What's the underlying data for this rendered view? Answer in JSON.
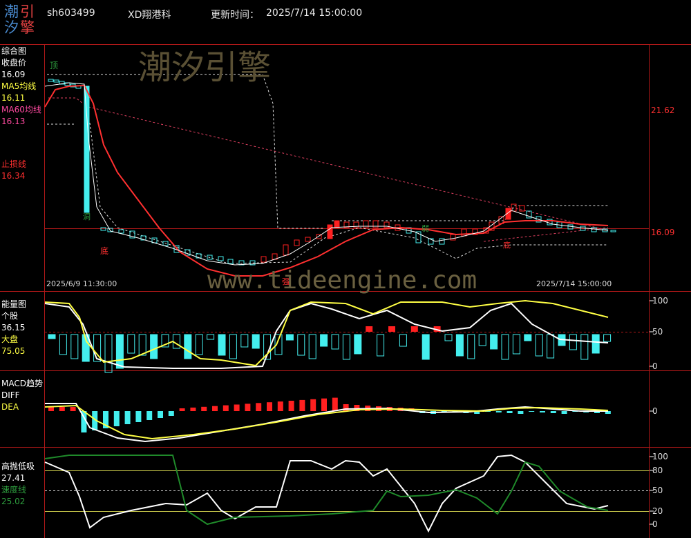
{
  "header": {
    "logo_chars": [
      "潮",
      "引",
      "汐",
      "擎"
    ],
    "code": "sh603499",
    "name": "XD翔港科",
    "update_label": "更新时间：",
    "update_time": "2025/7/14 15:00:00"
  },
  "watermark": {
    "text": "潮汐引擎",
    "url": "www.tideengine.com"
  },
  "panel1": {
    "labels": [
      {
        "text": "综合图",
        "color": "#ffffff"
      },
      {
        "text": "收盘价",
        "color": "#ffffff"
      },
      {
        "text": "16.09",
        "color": "#ffffff"
      },
      {
        "text": "MA5均线",
        "color": "#ffff44"
      },
      {
        "text": "16.11",
        "color": "#ffff44"
      },
      {
        "text": "MA60均线",
        "color": "#ff4aa0"
      },
      {
        "text": "16.13",
        "color": "#ff4aa0"
      },
      {
        "text": "止损线",
        "color": "#ff3030"
      },
      {
        "text": "16.34",
        "color": "#ff3030"
      }
    ],
    "axis": [
      "21.62",
      "16.09"
    ],
    "date_start": "2025/6/9 11:30:00",
    "date_end": "2025/7/14 15:00:00",
    "markers": {
      "top": "顶",
      "bottom": "底",
      "dig": "洞",
      "strong": "强",
      "bottom2": "底",
      "weak": "弱"
    }
  },
  "panel2": {
    "labels": [
      {
        "text": "能量图",
        "color": "#ffffff"
      },
      {
        "text": "个股",
        "color": "#ffffff"
      },
      {
        "text": "36.15",
        "color": "#ffffff"
      },
      {
        "text": "大盘",
        "color": "#ffff44"
      },
      {
        "text": "75.05",
        "color": "#ffff44"
      }
    ],
    "axis": [
      "100",
      "50",
      "0"
    ]
  },
  "panel3": {
    "labels": [
      {
        "text": "MACD趋势",
        "color": "#ffffff"
      },
      {
        "text": "DIFF",
        "color": "#ffffff"
      },
      {
        "text": "DEA",
        "color": "#ffff44"
      }
    ],
    "axis": [
      "0"
    ]
  },
  "panel4": {
    "labels": [
      {
        "text": "高抛低吸",
        "color": "#ffffff"
      },
      {
        "text": "27.41",
        "color": "#ffffff"
      },
      {
        "text": "速度线",
        "color": "#2e9e3e"
      },
      {
        "text": "25.02",
        "color": "#2e9e3e"
      }
    ],
    "axis": [
      "100",
      "80",
      "50",
      "20",
      "0"
    ]
  },
  "colors": {
    "up": "#ff2020",
    "down": "#44eeee",
    "frame": "#b01818",
    "ma5": "#ffff44",
    "ma60": "#ff3030",
    "speed": "#1f8a2a"
  }
}
